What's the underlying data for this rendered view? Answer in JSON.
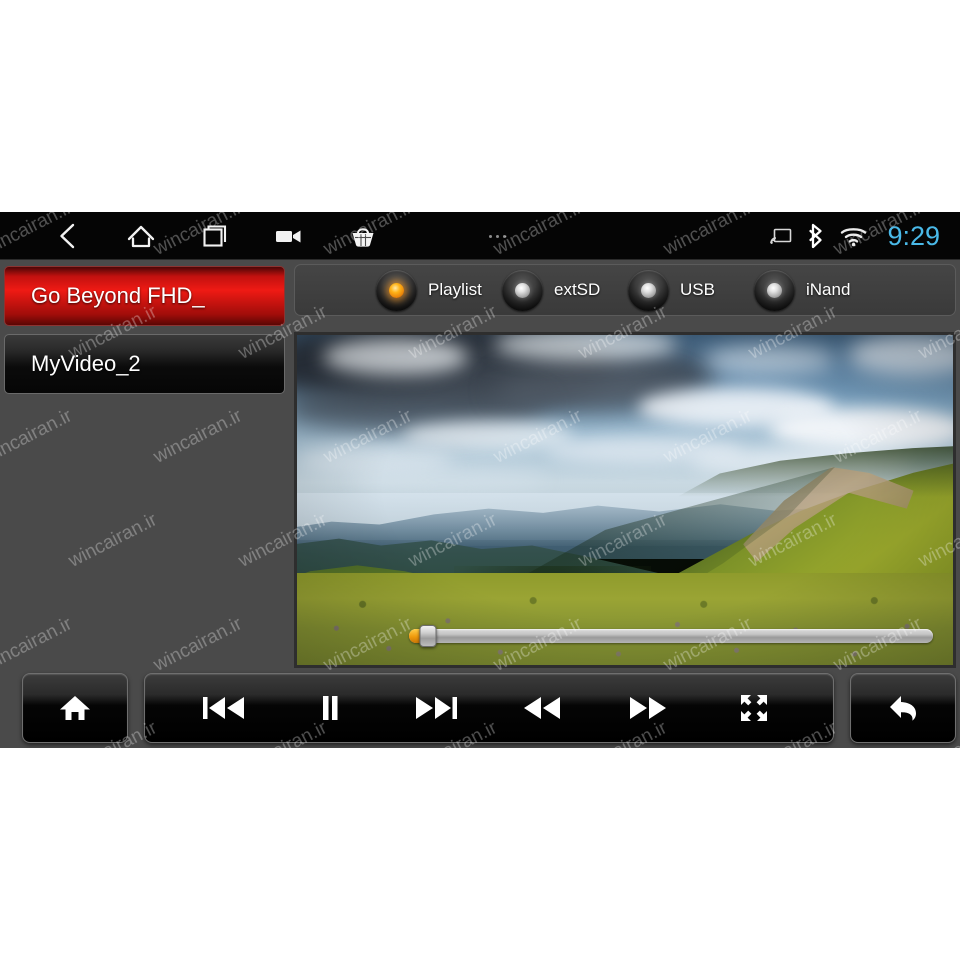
{
  "statusbar": {
    "icons_left": [
      {
        "name": "back-icon",
        "label": "Back"
      },
      {
        "name": "home-icon",
        "label": "Home"
      },
      {
        "name": "recents-icon",
        "label": "Recent apps"
      },
      {
        "name": "video-camera-icon",
        "label": "Camera"
      },
      {
        "name": "basket-icon",
        "label": "Apps"
      },
      {
        "name": "more-ellipsis-icon",
        "label": "More"
      }
    ],
    "icons_right": [
      {
        "name": "cast-screen-icon",
        "label": "Cast"
      },
      {
        "name": "bluetooth-icon",
        "label": "Bluetooth"
      },
      {
        "name": "wifi-icon",
        "label": "Wi-Fi"
      }
    ],
    "clock": "9:29",
    "clock_color": "#4ab9e8"
  },
  "playlist": {
    "items": [
      {
        "label": "Go Beyond FHD_",
        "selected": true
      },
      {
        "label": "MyVideo_2",
        "selected": false
      }
    ],
    "selected_color": "#ef1a14"
  },
  "sources": {
    "items": [
      {
        "label": "Playlist",
        "selected": true
      },
      {
        "label": "extSD",
        "selected": false
      },
      {
        "label": "USB",
        "selected": false
      },
      {
        "label": "iNand",
        "selected": false
      }
    ],
    "active_indicator_color": "#ffb317",
    "inactive_indicator_color": "#e2e2e2"
  },
  "video": {
    "scene": "mountain-landscape-with-clouds-and-alpine-meadow",
    "seek": {
      "progress_percent": 2,
      "fill_color": "#f09a0c",
      "track_color": "#c4c4c4"
    }
  },
  "controls": {
    "home": {
      "label": "Home",
      "icon": "home-icon"
    },
    "transport": [
      {
        "label": "Previous",
        "icon": "previous-track-icon"
      },
      {
        "label": "Pause",
        "icon": "pause-icon"
      },
      {
        "label": "Next",
        "icon": "next-track-icon"
      },
      {
        "label": "Rewind",
        "icon": "rewind-icon"
      },
      {
        "label": "Fast forward",
        "icon": "fast-forward-icon"
      },
      {
        "label": "Fullscreen",
        "icon": "fullscreen-icon"
      }
    ],
    "back": {
      "label": "Back",
      "icon": "back-arrow-icon"
    }
  },
  "watermark": {
    "text": "wincairan.ir"
  }
}
